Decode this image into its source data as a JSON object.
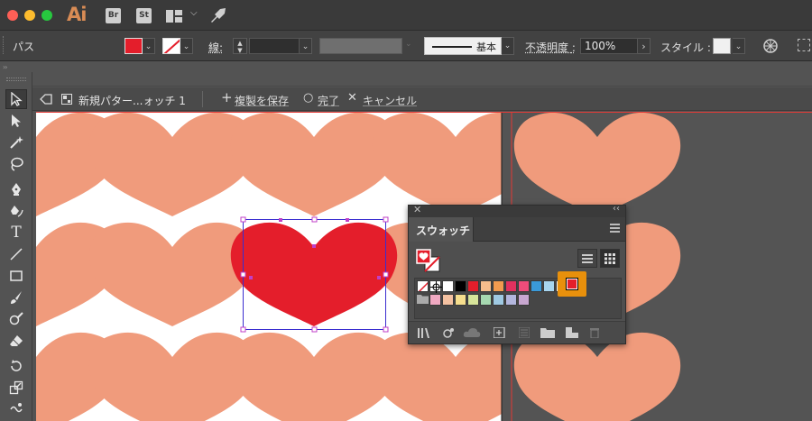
{
  "titlebar": {
    "app_logo": "Ai",
    "bridge_label": "Br",
    "stock_label": "St",
    "icons": [
      "workspace-icon",
      "chevron-down-icon",
      "rocket-icon"
    ]
  },
  "controlbar": {
    "selection_label": "パス",
    "stroke_label": "線",
    "brush_label": "基本",
    "opacity_label": "不透明度",
    "opacity_value": "100%",
    "style_label": "スタイル",
    "colon": ":",
    "fill_color": "#e41e2b"
  },
  "isolation": {
    "pattern_name": "新規パター...ォッチ 1",
    "save_copy_label": "複製を保存",
    "done_label": "完了",
    "cancel_label": "キャンセル",
    "plus_glyph": "+",
    "circle_glyph": "○",
    "cross_glyph": "✕"
  },
  "tools": {
    "items": [
      "selection-tool",
      "direct-selection-tool",
      "magic-wand-tool",
      "lasso-tool",
      "pen-tool",
      "curvature-tool",
      "type-tool",
      "line-tool",
      "rectangle-tool",
      "paintbrush-tool",
      "shaper-tool",
      "eraser-tool",
      "rotate-tool",
      "scale-tool",
      "warp-tool"
    ],
    "type_label": "T"
  },
  "swatches_panel": {
    "tab_label": "スウォッチ",
    "close_glyph": "✕",
    "collapse_glyph": "‹‹",
    "swatches_row1": [
      "none",
      "registration",
      "#ffffff",
      "#000000",
      "#e41e2b",
      "#f6bd8c",
      "#f29b4f",
      "#e2315f",
      "#ef4c7a",
      "#3a9ad9",
      "#a7d5ef",
      "#dbe9f4",
      "gradient",
      "selected"
    ],
    "swatches_row2": [
      "folder",
      "#f0a9c2",
      "#f4c1a1",
      "#f6de8d",
      "#d7e49a",
      "#a6d8b0",
      "#9fc9e2",
      "#b3b6dd",
      "#c8a7d0"
    ]
  },
  "canvas": {
    "heart_pattern_color": "#f09b7c",
    "selected_heart_color": "#e41e2b",
    "artboard_color": "#ffffff",
    "pasteboard_color": "#545454",
    "guide_color": "#e53935",
    "selection_color": "#3a2ed0",
    "anchor_color": "#c040c8"
  }
}
